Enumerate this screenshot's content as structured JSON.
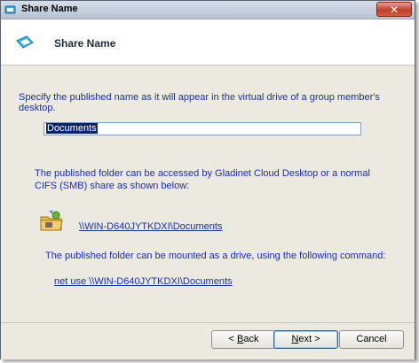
{
  "window": {
    "title": "Share Name",
    "close_label": "✕"
  },
  "header": {
    "title": "Share Name",
    "icon": "share-wizard-icon"
  },
  "content": {
    "instruction": "Specify the published name as it will appear in the virtual drive of a group member's desktop.",
    "share_name_value": "Documents",
    "access_description": "The published folder can be accessed by Gladinet Cloud Desktop or a normal CIFS (SMB) share as shown below:",
    "unc_path": "\\\\WIN-D640JYTKDXI\\Documents",
    "mount_description": "The published folder can be mounted as a drive, using the following command:",
    "mount_command": "net use \\\\WIN-D640JYTKDXI\\Documents"
  },
  "buttons": {
    "back_prefix": "< ",
    "back_key": "B",
    "back_rest": "ack",
    "next_key": "N",
    "next_rest": "ext >",
    "cancel": "Cancel"
  }
}
